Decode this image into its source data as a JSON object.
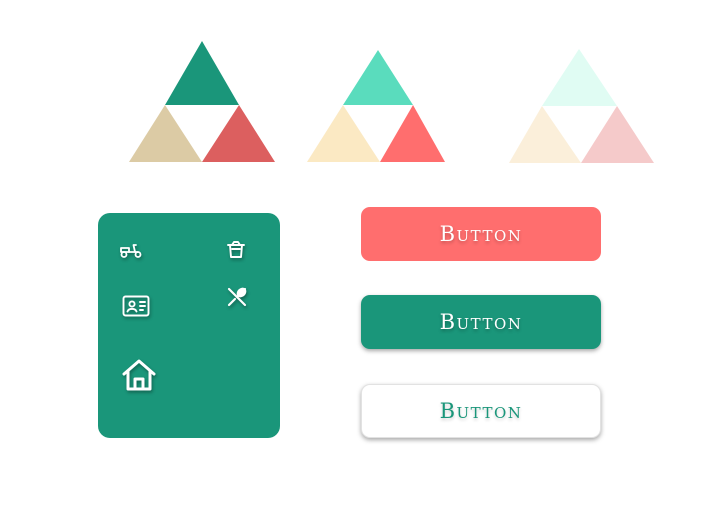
{
  "palette": {
    "green": "#1a967a",
    "tan": "#dccba5",
    "coral_dark": "#dc5f5f",
    "mint": "#5adcbd",
    "cream": "#fbe9c3",
    "coral": "#ff6e6e",
    "mint_pale": "#e0fcf3",
    "cream_pale": "#fbefda",
    "pink_pale": "#f5caca",
    "white": "#ffffff"
  },
  "swatch_groups": [
    {
      "top": "green",
      "left": "tan",
      "right": "coral_dark"
    },
    {
      "top": "mint",
      "left": "cream",
      "right": "coral"
    },
    {
      "top": "mint_pale",
      "left": "cream_pale",
      "right": "pink_pale"
    }
  ],
  "icon_panel": {
    "background": "#1a967a",
    "icons": [
      "scooter-icon",
      "takeout-box-icon",
      "id-card-icon",
      "utensils-icon",
      "home-icon"
    ]
  },
  "buttons": [
    {
      "label": "Button",
      "background": "#ff6e6e",
      "text_color": "#ffffff"
    },
    {
      "label": "Button",
      "background": "#1a967a",
      "text_color": "#ffffff"
    },
    {
      "label": "Button",
      "background": "#ffffff",
      "text_color": "#1a967a"
    }
  ]
}
